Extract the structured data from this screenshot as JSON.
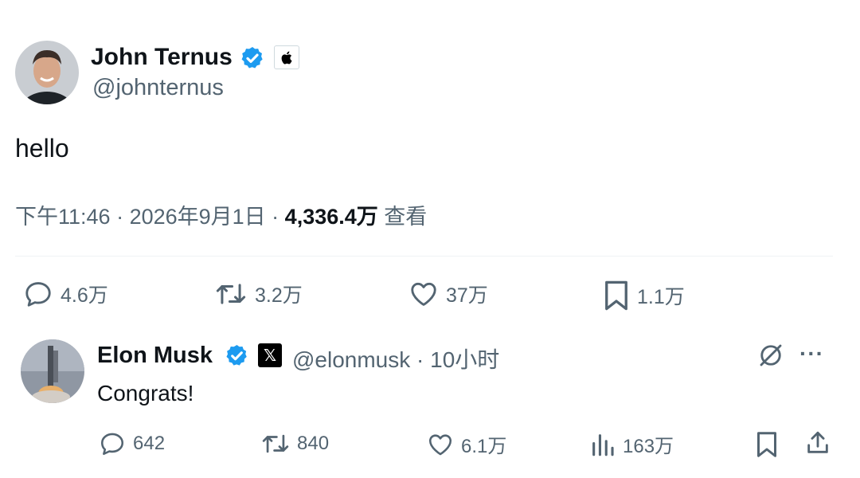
{
  "main_tweet": {
    "author_name": "John Ternus",
    "author_handle": "@johnternus",
    "text": "hello",
    "time": "下午11:46",
    "date": "2026年9月1日",
    "separator": " · ",
    "views_count": "4,336.4万",
    "views_label": "查看",
    "affiliate_icon": "apple-logo",
    "actions": {
      "replies": "4.6万",
      "retweets": "3.2万",
      "likes": "37万",
      "bookmarks": "1.1万"
    }
  },
  "reply": {
    "author_name": "Elon Musk",
    "author_handle": "@elonmusk",
    "time_ago": "10小时",
    "separator": " · ",
    "text": "Congrats!",
    "affiliate_icon": "x-logo",
    "x_glyph": "𝕏",
    "more_glyph": "···",
    "actions": {
      "replies": "642",
      "retweets": "840",
      "likes": "6.1万",
      "views": "163万"
    }
  },
  "colors": {
    "verified_blue": "#1d9bf0",
    "secondary_text": "#536471",
    "primary_text": "#0f1419",
    "divider": "#eff3f4"
  }
}
